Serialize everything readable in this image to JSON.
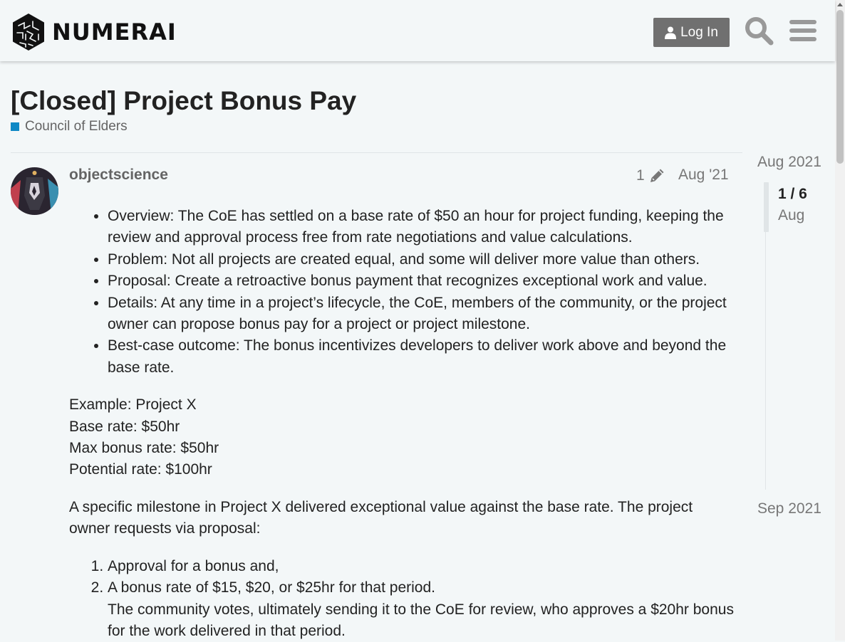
{
  "header": {
    "logo_text": "NUMERAI",
    "login_label": "Log In",
    "icons": [
      "user-icon",
      "search-icon",
      "hamburger-menu-icon"
    ]
  },
  "topic": {
    "title": "[Closed] Project Bonus Pay",
    "category": {
      "name": "Council of Elders",
      "color": "#0e88c5"
    }
  },
  "post": {
    "username": "objectscience",
    "edit_count": "1",
    "date": "Aug '21",
    "bullets": [
      "Overview: The CoE has settled on a base rate of $50 an hour for project funding, keeping the review and approval process free from rate negotiations and value calculations.",
      "Problem: Not all projects are created equal, and some will deliver more value than others.",
      "Proposal: Create a retroactive bonus payment that recognizes exceptional work and value.",
      "Details: At any time in a project’s lifecycle, the CoE, members of the community, or the project owner can propose bonus pay for a project or project milestone.",
      "Best-case outcome: The bonus incentivizes developers to deliver work above and beyond the base rate."
    ],
    "example": {
      "line1": "Example: Project X",
      "line2": "Base rate: $50hr",
      "line3": "Max bonus rate: $50hr",
      "line4": "Potential rate: $100hr"
    },
    "paragraph": "A specific milestone in Project X delivered exceptional value against the base rate. The project owner requests via proposal:",
    "steps": {
      "item1": "Approval for a bonus and,",
      "item2_line1": "A bonus rate of $15, $20, or $25hr for that period.",
      "item2_line2": "The community votes, ultimately sending it to the CoE for review, who approves a $20hr bonus for the work delivered in that period."
    }
  },
  "timeline": {
    "start": "Aug 2021",
    "position": "1 / 6",
    "position_date": "Aug",
    "end": "Sep 2021"
  },
  "colors": {
    "background": "#f3f7f8",
    "login_button": "#707070",
    "category": "#0e88c5"
  }
}
